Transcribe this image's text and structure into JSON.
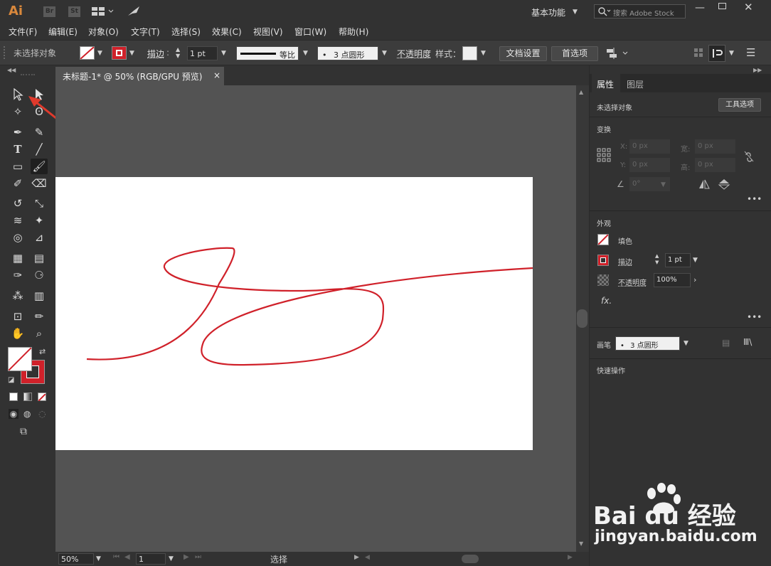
{
  "app": {
    "logo": "Ai",
    "bridge": "Br",
    "stock": "St",
    "workspace": "基本功能",
    "search_placeholder": "搜索 Adobe Stock"
  },
  "menu": [
    "文件(F)",
    "编辑(E)",
    "对象(O)",
    "文字(T)",
    "选择(S)",
    "效果(C)",
    "视图(V)",
    "窗口(W)",
    "帮助(H)"
  ],
  "control_bar": {
    "selection_status": "未选择对象",
    "stroke_label": "描边",
    "stroke_weight": "1 pt",
    "profile": "等比",
    "brush": "3 点圆形",
    "opacity_label": "不透明度",
    "style_label": "样式：",
    "doc_setup_button": "文档设置",
    "prefs_button": "首选项"
  },
  "document_tab": {
    "title": "未标题-1* @ 50% (RGB/GPU 预览)",
    "close": "×"
  },
  "status_bar": {
    "zoom": "50%",
    "artboard_number": "1",
    "tool_name": "选择"
  },
  "properties_panel": {
    "tabs": [
      "属性",
      "图层"
    ],
    "selection_status": "未选择对象",
    "tool_options_button": "工具选项",
    "transform": {
      "title": "变换",
      "x_label": "X:",
      "x_value": "0 px",
      "y_label": "Y:",
      "y_value": "0 px",
      "w_label": "宽:",
      "w_value": "0 px",
      "h_label": "高:",
      "h_value": "0 px",
      "angle_value": "0°"
    },
    "appearance": {
      "title": "外观",
      "fill_label": "填色",
      "stroke_label": "描边",
      "stroke_weight": "1 pt",
      "opacity_label": "不透明度",
      "opacity_value": "100%",
      "fx_label": "fx."
    },
    "brush": {
      "label": "画笔",
      "value": "3 点圆形"
    },
    "quick_actions_title": "快速操作"
  },
  "colors": {
    "stroke": "#d0212a",
    "ui_dark": "#323232",
    "ui_canvas": "#535353",
    "highlight": "#e03a2c"
  },
  "watermark": {
    "logo_text": "Bai du 经验",
    "url": "jingyan.baidu.com"
  }
}
